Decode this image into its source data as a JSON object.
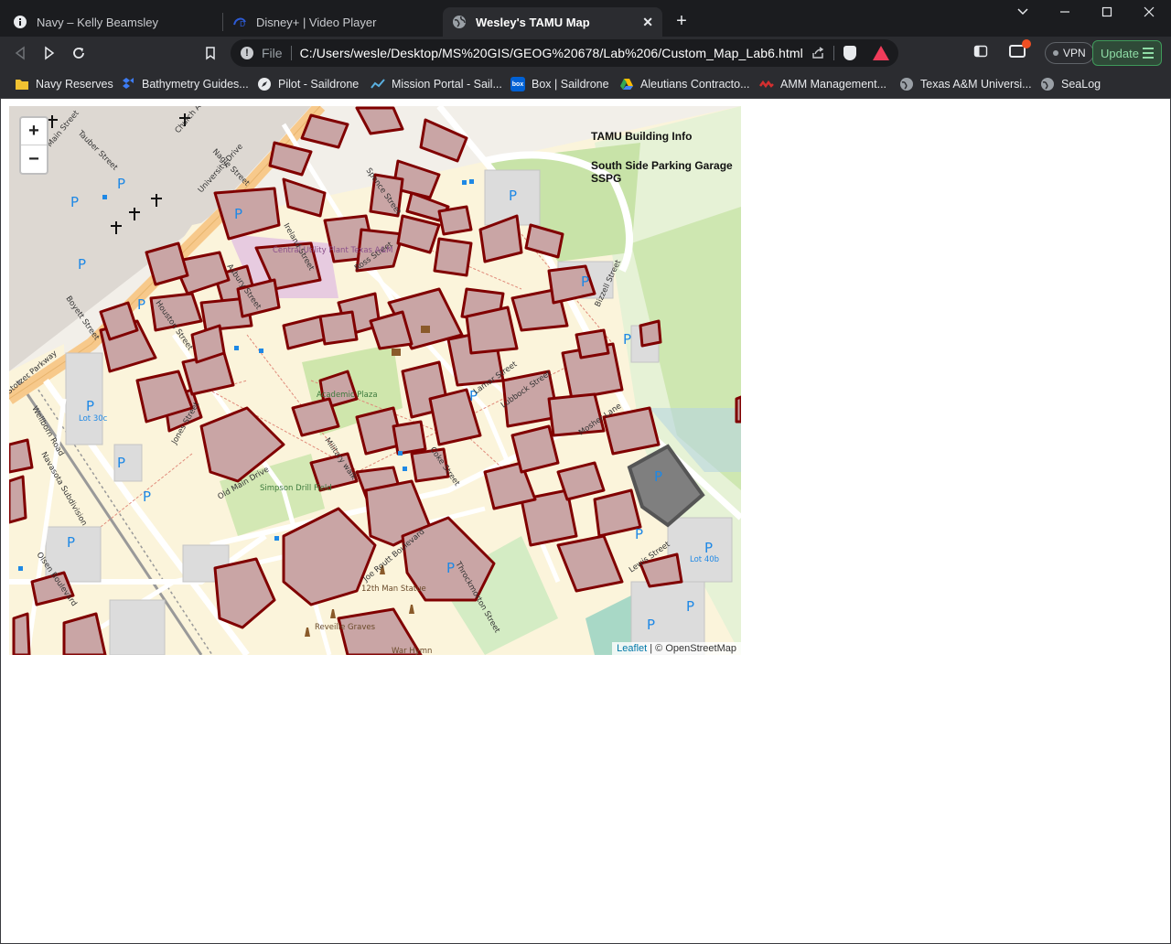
{
  "tabs": [
    {
      "title": "Navy – Kelly Beamsley",
      "icon": "info-icon"
    },
    {
      "title": "Disney+ | Video Player",
      "icon": "disney-plus-icon"
    },
    {
      "title": "Wesley's TAMU Map",
      "icon": "globe-icon",
      "active": true
    }
  ],
  "address": {
    "scheme": "File",
    "url": "C:/Users/wesle/Desktop/MS%20GIS/GEOG%20678/Lab%206/Custom_Map_Lab6.html"
  },
  "toolbar": {
    "vpn_label": "VPN",
    "update_label": "Update"
  },
  "bookmarks": [
    {
      "label": "Navy Reserves",
      "icon": "folder-icon",
      "color": "#f1c232"
    },
    {
      "label": "Bathymetry Guides...",
      "icon": "dropbox-icon",
      "color": "#0061fe"
    },
    {
      "label": "Pilot - Saildrone",
      "icon": "compass-icon",
      "color": "#4a7fd1"
    },
    {
      "label": "Mission Portal - Sail...",
      "icon": "chart-line-icon",
      "color": "#5ab0e0"
    },
    {
      "label": "Box | Saildrone",
      "icon": "box-icon",
      "color": "#0061d5"
    },
    {
      "label": "Aleutians Contracto...",
      "icon": "google-drive-icon",
      "color": "#34a853"
    },
    {
      "label": "AMM Management...",
      "icon": "amm-icon",
      "color": "#d32f2f"
    },
    {
      "label": "Texas A&M Universi...",
      "icon": "globe-icon",
      "color": "#9aa0a6"
    },
    {
      "label": "SeaLog",
      "icon": "globe-icon",
      "color": "#9aa0a6"
    }
  ],
  "map": {
    "zoom_in": "+",
    "zoom_out": "−",
    "info_title": "TAMU Building Info",
    "info_name": "South Side Parking Garage",
    "info_code": "SSPG",
    "attribution_link": "Leaflet",
    "attribution_text": "| © OpenStreetMap",
    "building_fill": "#c9a5a5",
    "building_stroke": "#800000",
    "highlight_fill": "#7f7f7f",
    "labels": {
      "streets": [
        "Tauber Street",
        "Church Avenue",
        "Nagle Street",
        "University Drive",
        "Spence Street",
        "Ireland Street",
        "Asbury Street",
        "Ross Street",
        "Houston Street",
        "Boyett Street",
        "Lamar Street",
        "Lubbock Street",
        "Mosher Lane",
        "Jones Street",
        "Old Main Drive",
        "Military walk",
        "Coke Street",
        "Throckmorton Street",
        "Joe Routt Boulevard",
        "Lewis Street",
        "Bizzell Street",
        "Wellborn Road",
        "Stotzer Parkway",
        "Olsen Boulevard",
        "Navasota Subdivision",
        "Main Street"
      ],
      "places": [
        "Academic Plaza",
        "Simpson Drill Field",
        "Central Utility Plant Texas A&M",
        "12th Man Statue",
        "Reveille Graves",
        "War Hymn",
        "Lot 30c",
        "Lot 40b"
      ]
    }
  }
}
